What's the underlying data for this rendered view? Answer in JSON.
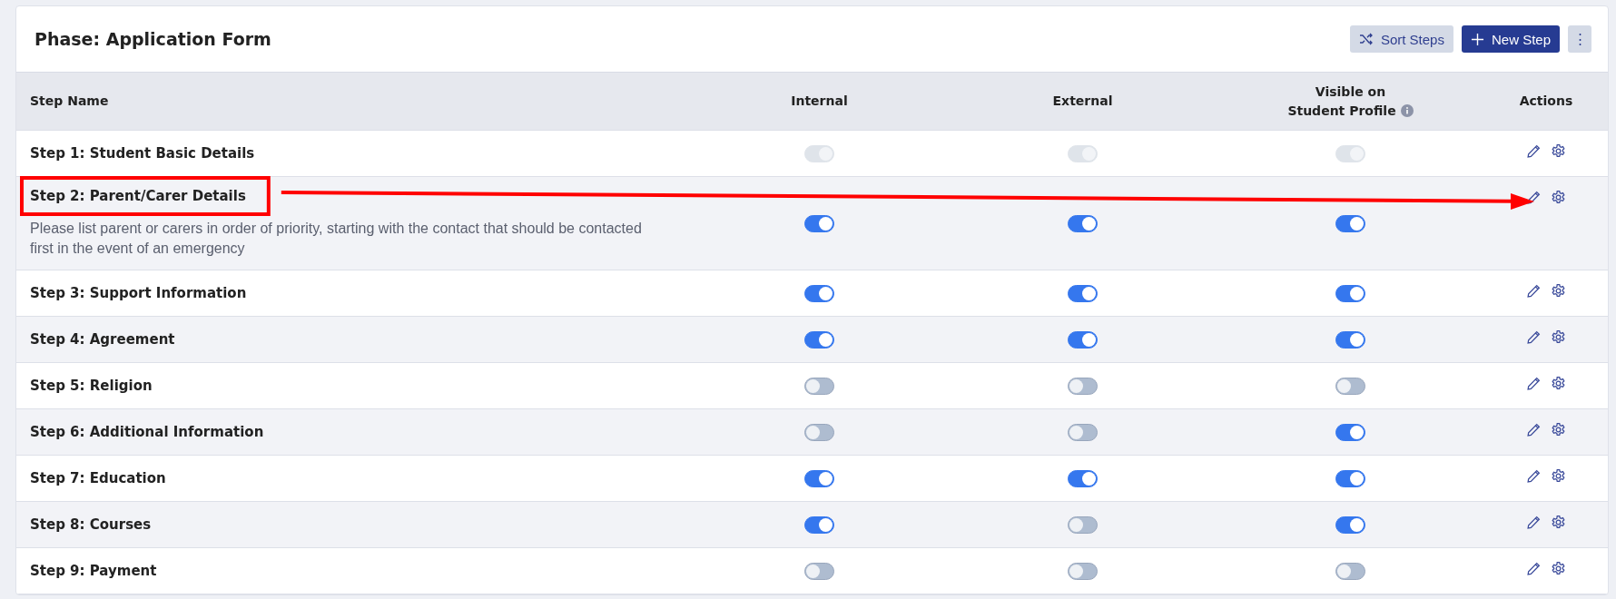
{
  "header": {
    "title": "Phase: Application Form",
    "buttons": [
      {
        "kind": "sort",
        "label": "Sort Steps"
      },
      {
        "kind": "new",
        "label": "New Step"
      },
      {
        "kind": "more",
        "label": "⋮"
      }
    ]
  },
  "table": {
    "columns": [
      {
        "label": "Step Name",
        "kind": "name"
      },
      {
        "label": "Internal",
        "kind": "toggle"
      },
      {
        "label": "External",
        "kind": "toggle"
      },
      {
        "label": "Visible on\nStudent Profile",
        "kind": "toggle",
        "info": true
      },
      {
        "label": "Actions",
        "kind": "actions"
      }
    ],
    "rows": [
      {
        "name": "Step 1: Student Basic Details",
        "highlighted": false,
        "internal": {
          "on": true,
          "disabled": true
        },
        "external": {
          "on": true,
          "disabled": true
        },
        "visible": {
          "on": true,
          "disabled": true
        }
      },
      {
        "name": "Step 2: Parent/Carer Details",
        "description": "Please list parent or carers in order of priority, starting with the contact that should be contacted first in the event of an emergency",
        "highlighted": true,
        "internal": {
          "on": true,
          "disabled": false
        },
        "external": {
          "on": true,
          "disabled": false
        },
        "visible": {
          "on": true,
          "disabled": false
        }
      },
      {
        "name": "Step 3: Support Information",
        "highlighted": false,
        "internal": {
          "on": true,
          "disabled": false
        },
        "external": {
          "on": true,
          "disabled": false
        },
        "visible": {
          "on": true,
          "disabled": false
        }
      },
      {
        "name": "Step 4: Agreement",
        "highlighted": false,
        "internal": {
          "on": true,
          "disabled": false
        },
        "external": {
          "on": true,
          "disabled": false
        },
        "visible": {
          "on": true,
          "disabled": false
        }
      },
      {
        "name": "Step 5: Religion",
        "highlighted": false,
        "internal": {
          "on": false,
          "disabled": false
        },
        "external": {
          "on": false,
          "disabled": false
        },
        "visible": {
          "on": false,
          "disabled": false
        }
      },
      {
        "name": "Step 6: Additional Information",
        "highlighted": false,
        "internal": {
          "on": false,
          "disabled": false
        },
        "external": {
          "on": false,
          "disabled": false
        },
        "visible": {
          "on": true,
          "disabled": false
        }
      },
      {
        "name": "Step 7: Education",
        "highlighted": false,
        "internal": {
          "on": true,
          "disabled": false
        },
        "external": {
          "on": true,
          "disabled": false
        },
        "visible": {
          "on": true,
          "disabled": false
        }
      },
      {
        "name": "Step 8: Courses",
        "highlighted": false,
        "internal": {
          "on": true,
          "disabled": false
        },
        "external": {
          "on": false,
          "disabled": false
        },
        "visible": {
          "on": true,
          "disabled": false
        }
      },
      {
        "name": "Step 9: Payment",
        "highlighted": false,
        "internal": {
          "on": false,
          "disabled": false
        },
        "external": {
          "on": false,
          "disabled": false
        },
        "visible": {
          "on": false,
          "disabled": false
        }
      }
    ]
  }
}
